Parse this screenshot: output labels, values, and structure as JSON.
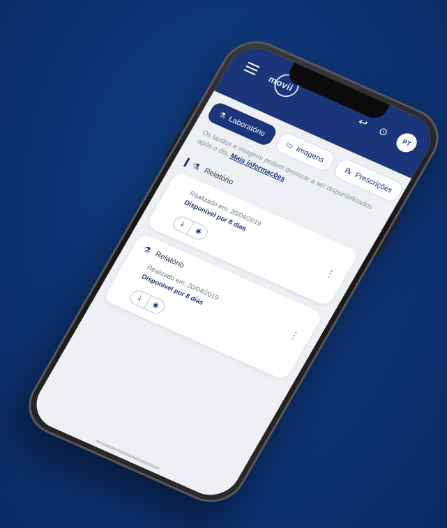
{
  "app": {
    "logo_text": "movii",
    "avatar_initials": "PT"
  },
  "tabs": [
    {
      "label": "Laboratório",
      "icon": "flask-icon",
      "active": true
    },
    {
      "label": "Imagens",
      "icon": "image-icon",
      "active": false
    },
    {
      "label": "Prescrições",
      "icon": "prescription-icon",
      "active": false
    }
  ],
  "notice": {
    "text": "Os laudos e imagens podem demorar a ser disponibilizados após o dia.",
    "link": "Mais informações"
  },
  "results": [
    {
      "title": "Relatório",
      "date_line": "Realizado em: 20/04/2019",
      "availability": "Disponível por 8 dias"
    },
    {
      "title": "Relatório",
      "date_line": "Realizado em: 20/04/2019",
      "availability": "Disponível por 8 dias"
    }
  ],
  "colors": {
    "brand": "#1a3579",
    "background": "#0d3272",
    "screen": "#eef0f4"
  }
}
